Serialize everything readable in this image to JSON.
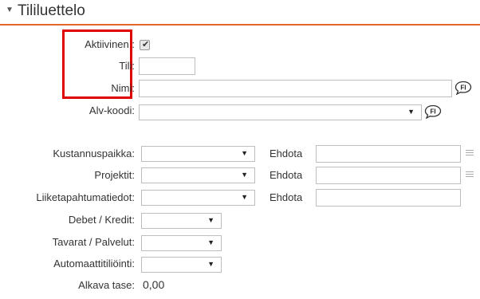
{
  "section": {
    "toggle_glyph": "▼",
    "title": "Tililuettelo",
    "accent_color": "#e2672e"
  },
  "fields": {
    "active_label": "Aktiivinen :",
    "active_checked": true,
    "account_label": "Tili:",
    "account_value": "",
    "name_label": "Nimi:",
    "name_value": "",
    "vat_label": "Alv-koodi:",
    "vat_value": "",
    "lang_badge": "FI"
  },
  "dimensions": {
    "cost_center_label": "Kustannuspaikka:",
    "projects_label": "Projektit:",
    "business_label": "Liiketapahtumatiedot:",
    "suggest_label": "Ehdota"
  },
  "settings": {
    "debit_credit_label": "Debet / Kredit:",
    "goods_services_label": "Tavarat / Palvelut:",
    "auto_posting_label": "Automaattitiliöinti:",
    "opening_balance_label": "Alkava tase:",
    "opening_balance_value": "0,00"
  },
  "icons": {
    "dropdown_arrow": "▼",
    "translate_icon": "speech-bubble-fi-icon",
    "list_icon": "list-icon"
  },
  "highlight_color": "#e00000"
}
